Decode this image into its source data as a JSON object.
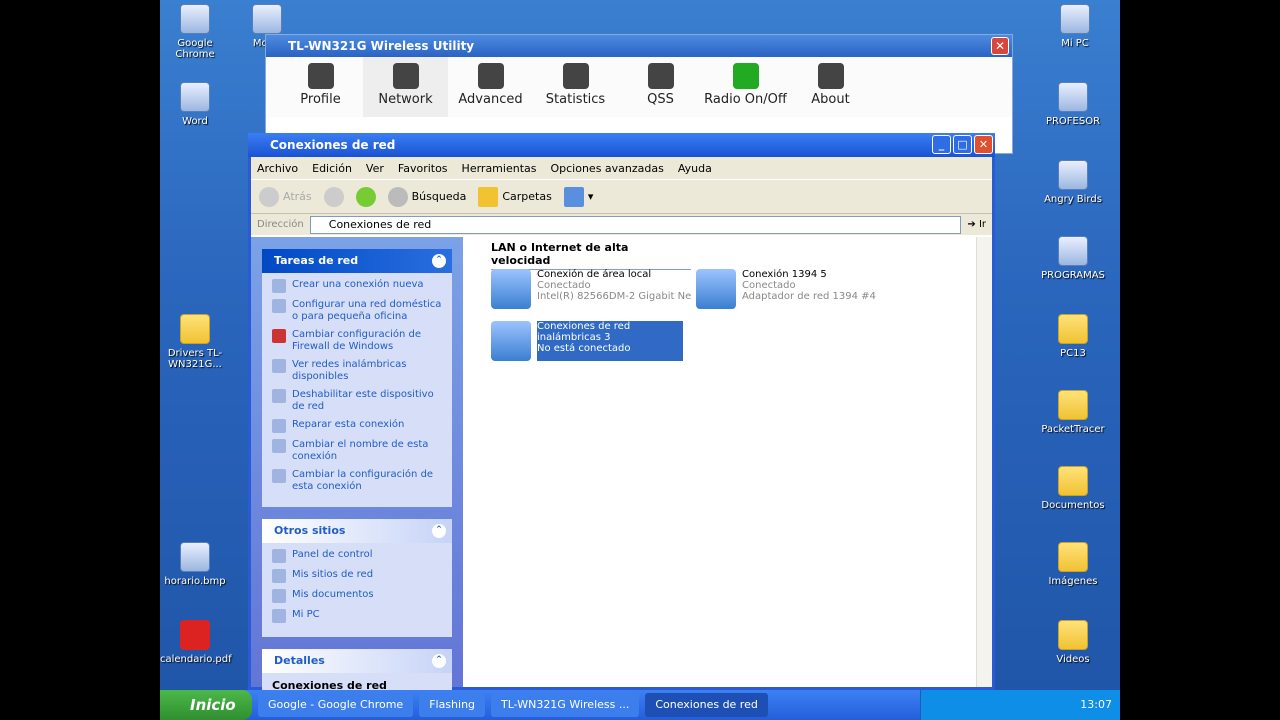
{
  "desktop": {
    "icons": [
      {
        "label": "Google Chrome",
        "icon": "chrome-icon"
      },
      {
        "label": "Mozill",
        "icon": "firefox-icon"
      },
      {
        "label": "Mi PC",
        "icon": "computer-icon"
      },
      {
        "label": "Word",
        "icon": "word-icon"
      },
      {
        "label": "PROFESOR",
        "icon": "computer-icon"
      },
      {
        "label": "Angry Birds",
        "icon": "app-icon"
      },
      {
        "label": "PROGRAMAS",
        "icon": "computer-icon"
      },
      {
        "label": "Drivers TL-WN321G...",
        "icon": "folder-icon"
      },
      {
        "label": "PC13",
        "icon": "folder-icon"
      },
      {
        "label": "PacketTracer",
        "icon": "folder-icon"
      },
      {
        "label": "Documentos",
        "icon": "folder-icon"
      },
      {
        "label": "horario.bmp",
        "icon": "image-icon"
      },
      {
        "label": "Imágenes",
        "icon": "folder-icon"
      },
      {
        "label": "calendario.pdf",
        "icon": "pdf-icon"
      },
      {
        "label": "Videos",
        "icon": "folder-icon"
      }
    ]
  },
  "tl": {
    "title": "TL-WN321G Wireless Utility",
    "tools": [
      {
        "label": "Profile"
      },
      {
        "label": "Network"
      },
      {
        "label": "Advanced"
      },
      {
        "label": "Statistics"
      },
      {
        "label": "QSS"
      },
      {
        "label": "Radio On/Off"
      },
      {
        "label": "About"
      }
    ]
  },
  "nc": {
    "title": "Conexiones de red",
    "menu": [
      "Archivo",
      "Edición",
      "Ver",
      "Favoritos",
      "Herramientas",
      "Opciones avanzadas",
      "Ayuda"
    ],
    "toolbar": {
      "back": "Atrás",
      "search": "Búsqueda",
      "folders": "Carpetas"
    },
    "address": {
      "label": "Dirección",
      "value": "Conexiones de red",
      "go": "Ir"
    },
    "tasks": {
      "title": "Tareas de red",
      "items": [
        "Crear una conexión nueva",
        "Configurar una red doméstica o para pequeña oficina",
        "Cambiar configuración de Firewall de Windows",
        "Ver redes inalámbricas disponibles",
        "Deshabilitar este dispositivo de red",
        "Reparar esta conexión",
        "Cambiar el nombre de esta conexión",
        "Cambiar la configuración de esta conexión"
      ]
    },
    "other": {
      "title": "Otros sitios",
      "items": [
        "Panel de control",
        "Mis sitios de red",
        "Mis documentos",
        "Mi PC"
      ]
    },
    "details": {
      "title": "Detalles",
      "subtitle": "Conexiones de red"
    },
    "group": "LAN o Internet de alta velocidad",
    "connections": [
      {
        "name": "Conexión de área local",
        "status": "Conectado",
        "device": "Intel(R) 82566DM-2 Gigabit Ne"
      },
      {
        "name": "Conexión 1394 5",
        "status": "Conectado",
        "device": "Adaptador de red 1394 #4"
      },
      {
        "name": "Conexiones de red inalámbricas 3",
        "status": "No está conectado",
        "device": ""
      }
    ]
  },
  "taskbar": {
    "start": "Inicio",
    "items": [
      "Google - Google Chrome",
      "Flashing",
      "TL-WN321G Wireless ...",
      "Conexiones de red"
    ],
    "clock": "13:07"
  }
}
